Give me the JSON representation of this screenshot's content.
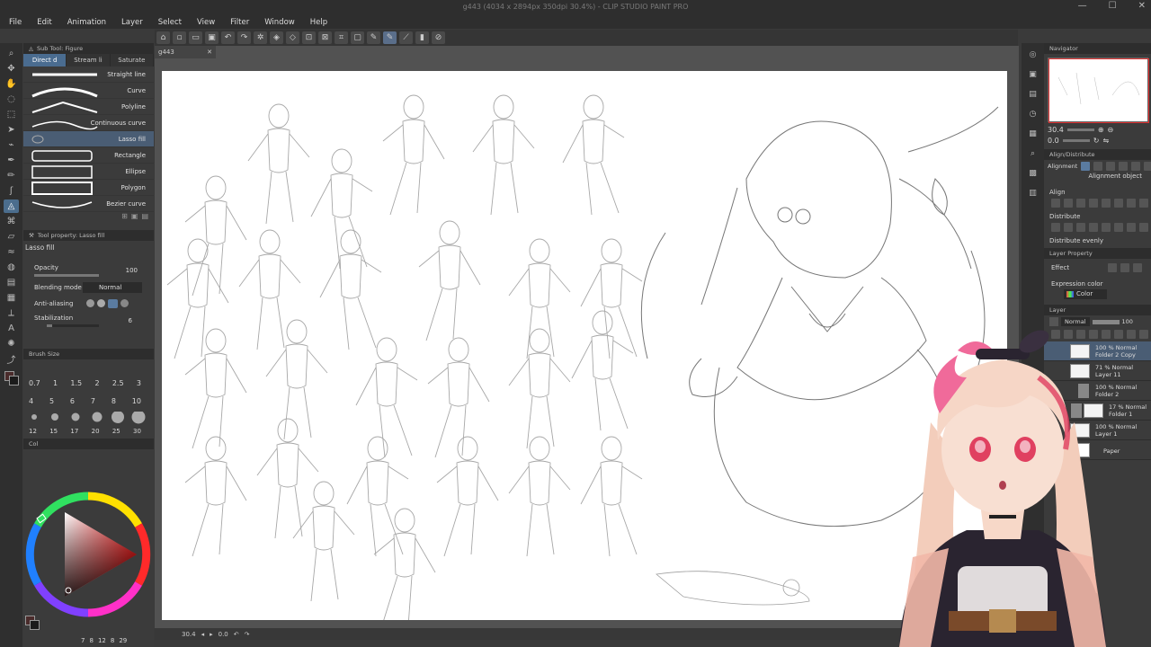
{
  "window": {
    "title": "g443 (4034 x 2894px 350dpi 30.4%)  - CLIP STUDIO PAINT PRO"
  },
  "menu": [
    "File",
    "Edit",
    "Animation",
    "Layer",
    "Select",
    "View",
    "Filter",
    "Window",
    "Help"
  ],
  "document_tab": {
    "name": "g443"
  },
  "sub_tool": {
    "title": "Sub Tool: Figure",
    "tabs": [
      "Direct d",
      "Stream li",
      "Saturate"
    ],
    "brushes": [
      "Straight line",
      "Curve",
      "Polyline",
      "Continuous curve",
      "Lasso fill",
      "Rectangle",
      "Ellipse",
      "Polygon",
      "Bezier curve"
    ],
    "selected": "Lasso fill"
  },
  "tool_property": {
    "title": "Tool property: Lasso fill",
    "tool_name": "Lasso fill",
    "opacity_label": "Opacity",
    "opacity_value": "100",
    "blending_label": "Blending mode",
    "blending_value": "Normal",
    "antialias_label": "Anti-aliasing",
    "stabilization_label": "Stabilization",
    "stabilization_value": "6"
  },
  "brush_size": {
    "title": "Brush Size",
    "row1": [
      "0.7",
      "1",
      "1.5",
      "2",
      "2.5",
      "3"
    ],
    "row2": [
      "4",
      "5",
      "6",
      "7",
      "8",
      "10"
    ],
    "row3": [
      "12",
      "15",
      "17",
      "20",
      "25",
      "30"
    ]
  },
  "color_wheel": {
    "title": "Col",
    "bottom_values": [
      "7",
      "8",
      "12",
      "8",
      "29"
    ]
  },
  "navigator": {
    "title": "Navigator",
    "zoom": "30.4",
    "angle": "0.0"
  },
  "align": {
    "title": "Align/Distribute",
    "alignment_label": "Alignment",
    "alignment_value": "Alignment object",
    "align_label": "Align",
    "distribute_label": "Distribute",
    "distribute_evenly_label": "Distribute evenly"
  },
  "layer_property": {
    "title": "Layer Property",
    "effect_label": "Effect",
    "expression_color_label": "Expression color",
    "expression_color_value": "Color"
  },
  "layers": {
    "title": "Layer",
    "blend": "Normal",
    "opacity": "100",
    "items": [
      {
        "line1": "100 % Normal",
        "line2": "Folder 2 Copy"
      },
      {
        "line1": "71 % Normal",
        "line2": "Layer 11"
      },
      {
        "line1": "100 % Normal",
        "line2": "Folder 2"
      },
      {
        "line1": "17 % Normal",
        "line2": "Folder 1"
      },
      {
        "line1": "100 % Normal",
        "line2": "Layer 1"
      },
      {
        "line1": "",
        "line2": "Paper"
      }
    ]
  },
  "status": {
    "zoom": "30.4",
    "angle": "0.0"
  },
  "colors": {
    "accent": "#4a6c90",
    "panel": "#3b3b3b",
    "canvas": "#ffffff",
    "avatar_hair": "#f6d6c6",
    "avatar_bow": "#f06a9a"
  }
}
